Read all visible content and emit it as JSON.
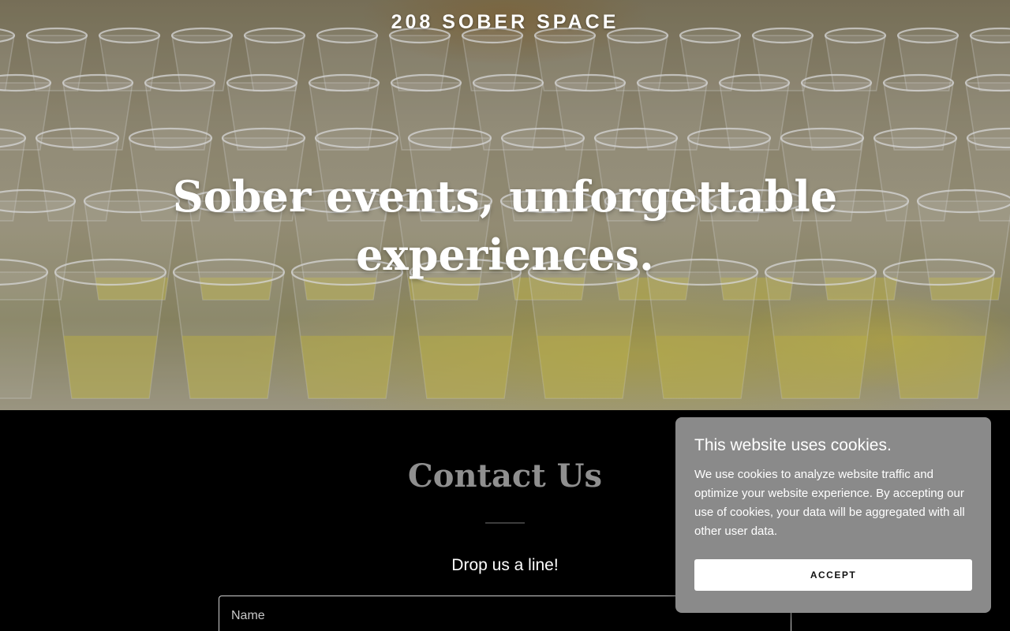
{
  "header": {
    "brand": "208 SOBER SPACE"
  },
  "hero": {
    "headline_line1": "Sober events, unforgettable",
    "headline_line2": "experiences.",
    "image_subject": "rows of champagne glasses"
  },
  "contact": {
    "title": "Contact Us",
    "subline": "Drop us a line!",
    "name_placeholder": "Name"
  },
  "cookie_banner": {
    "title": "This website uses cookies.",
    "body": "We use cookies to analyze website traffic and optimize your website experience. By accepting our use of cookies, your data will be aggregated with all other user data.",
    "accept_label": "ACCEPT"
  },
  "colors": {
    "page_background": "#000000",
    "cookie_background": "#8a8a8a",
    "contact_title": "#8f8f8f",
    "wine_gold": "#d8cc52"
  }
}
